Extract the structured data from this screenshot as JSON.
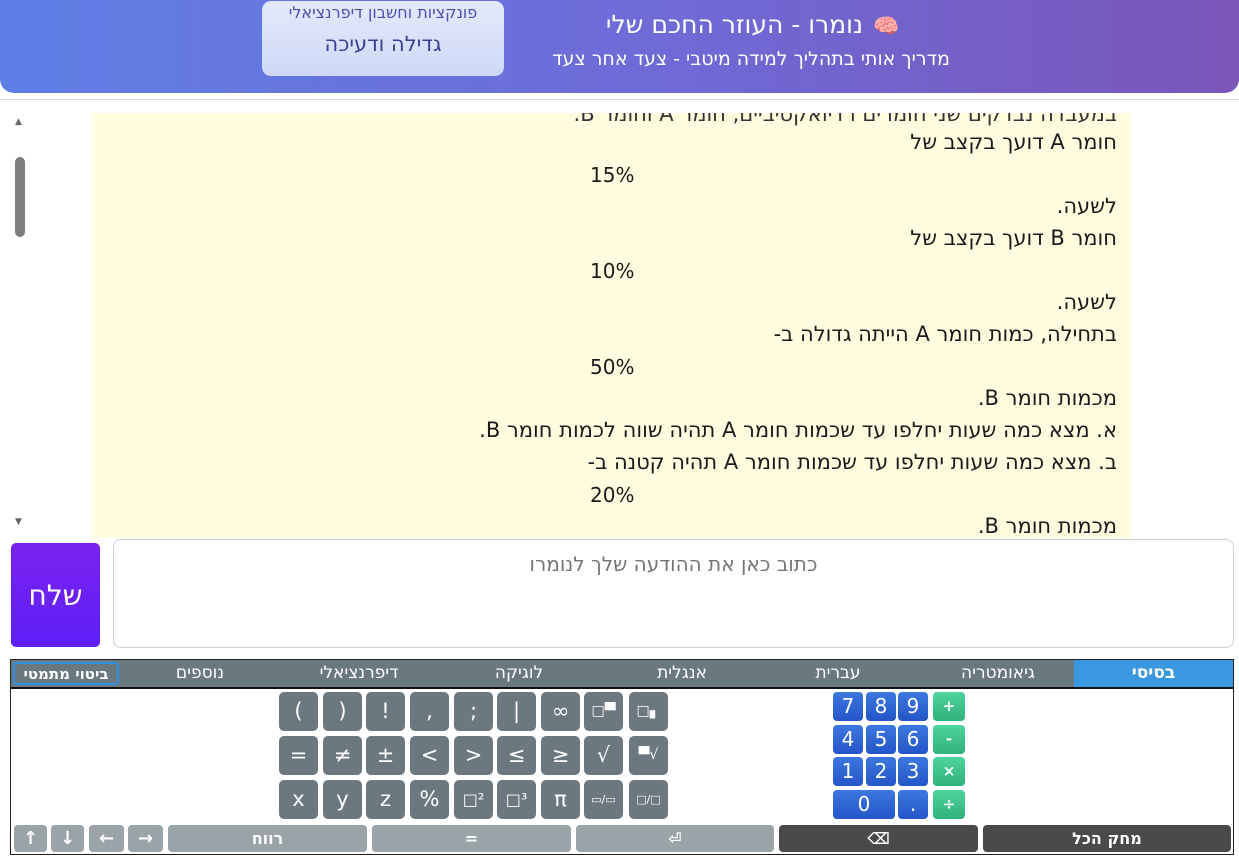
{
  "header": {
    "title": "נומרו - העוזר החכם שלי",
    "subtitle": "מדריך אותי בתהליך למידה מיטבי - צעד אחר צעד",
    "topic_category": "פונקציות וחשבון דיפרנציאלי",
    "topic_name": "גדילה ודעיכה",
    "icon": "brain-icon"
  },
  "message": {
    "cut_line": "במעבדה נבדקים שני חומרים רדיואקטיביים, חומר A וחומר B.",
    "line1": "חומר A דועך בקצב של",
    "pct1": "15%",
    "line2": "לשעה.",
    "line3": "חומר B דועך בקצב של",
    "pct2": "10%",
    "line4": "לשעה.",
    "line5": "בתחילה, כמות חומר A הייתה גדולה ב-",
    "pct3": "50%",
    "line6": "מכמות חומר B.",
    "line7": "א. מצא כמה שעות יחלפו עד שכמות חומר A תהיה שווה לכמות חומר B.",
    "line8": "ב. מצא כמה שעות יחלפו עד שכמות חומר A תהיה קטנה ב-",
    "pct4": "20%",
    "line9": "מכמות חומר B."
  },
  "input": {
    "placeholder": "כתוב כאן את ההודעה שלך לנומרו",
    "send_label": "שלח"
  },
  "keyboard": {
    "tabs": [
      "בסיסי",
      "גיאומטריה",
      "עברית",
      "אנגלית",
      "לוגיקה",
      "דיפרנציאלי",
      "נוספים"
    ],
    "active_tab": "בסיסי",
    "expression_tab": "ביטוי מתמטי",
    "row1": [
      "(",
      ")",
      "!",
      ",",
      ";",
      "|",
      "∞",
      "□▀",
      "□▖"
    ],
    "row2": [
      "=",
      "≠",
      "±",
      "<",
      ">",
      "≤",
      "≥",
      "√",
      "▀√"
    ],
    "row3": [
      "x",
      "y",
      "z",
      "%",
      "□²",
      "□³",
      "π",
      "▭/▭",
      "□/□"
    ],
    "digits": [
      "7",
      "8",
      "9",
      "4",
      "5",
      "6",
      "1",
      "2",
      "3",
      "0",
      "."
    ],
    "operators": [
      "+",
      "-",
      "×",
      "÷"
    ],
    "bottom": {
      "up": "↑",
      "down": "↓",
      "left": "←",
      "right": "→",
      "space": "רווח",
      "equals": "=",
      "enter": "⏎",
      "backspace": "⌫",
      "clear_all": "מחק הכל"
    }
  }
}
